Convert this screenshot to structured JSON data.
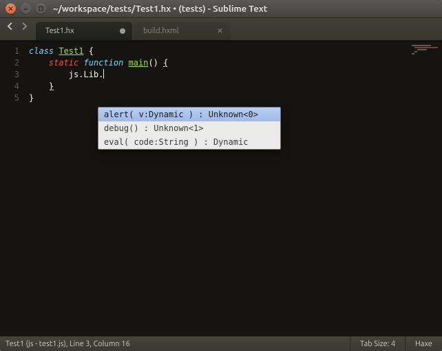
{
  "window": {
    "title": "~/workspace/tests/Test1.hx • (tests) - Sublime Text"
  },
  "tabs": [
    {
      "label": "Test1.hx",
      "active": true,
      "dirty": true
    },
    {
      "label": "build.hxml",
      "active": false,
      "dirty": false
    }
  ],
  "code": {
    "lines": [
      {
        "n": "1",
        "tokens": [
          {
            "t": "class ",
            "c": "kw-storage"
          },
          {
            "t": "Test1",
            "c": "ent"
          },
          {
            "t": " {",
            "c": ""
          }
        ]
      },
      {
        "n": "2",
        "tokens": [
          {
            "t": "    ",
            "c": ""
          },
          {
            "t": "static",
            "c": "kw-static"
          },
          {
            "t": " ",
            "c": ""
          },
          {
            "t": "function",
            "c": "kw-storage"
          },
          {
            "t": " ",
            "c": ""
          },
          {
            "t": "main",
            "c": "ent"
          },
          {
            "t": "()",
            "c": "param"
          },
          {
            "t": " ",
            "c": ""
          },
          {
            "t": "{",
            "c": "bracket-u"
          }
        ]
      },
      {
        "n": "3",
        "tokens": [
          {
            "t": "        js.Lib.",
            "c": ""
          }
        ],
        "cursor": true
      },
      {
        "n": "4",
        "tokens": [
          {
            "t": "    ",
            "c": ""
          },
          {
            "t": "}",
            "c": "bracket-u"
          }
        ]
      },
      {
        "n": "5",
        "tokens": [
          {
            "t": "}",
            "c": ""
          }
        ]
      }
    ]
  },
  "autocomplete": {
    "items": [
      {
        "text": "alert( v:Dynamic ) : Unknown<0>",
        "selected": true
      },
      {
        "text": "debug() : Unknown<1>",
        "selected": false
      },
      {
        "text": "eval( code:String ) : Dynamic",
        "selected": false
      }
    ]
  },
  "status": {
    "left": "Test1 (js - test1.js), Line 3, Column 16",
    "tab_size": "Tab Size: 4",
    "syntax": "Haxe"
  }
}
